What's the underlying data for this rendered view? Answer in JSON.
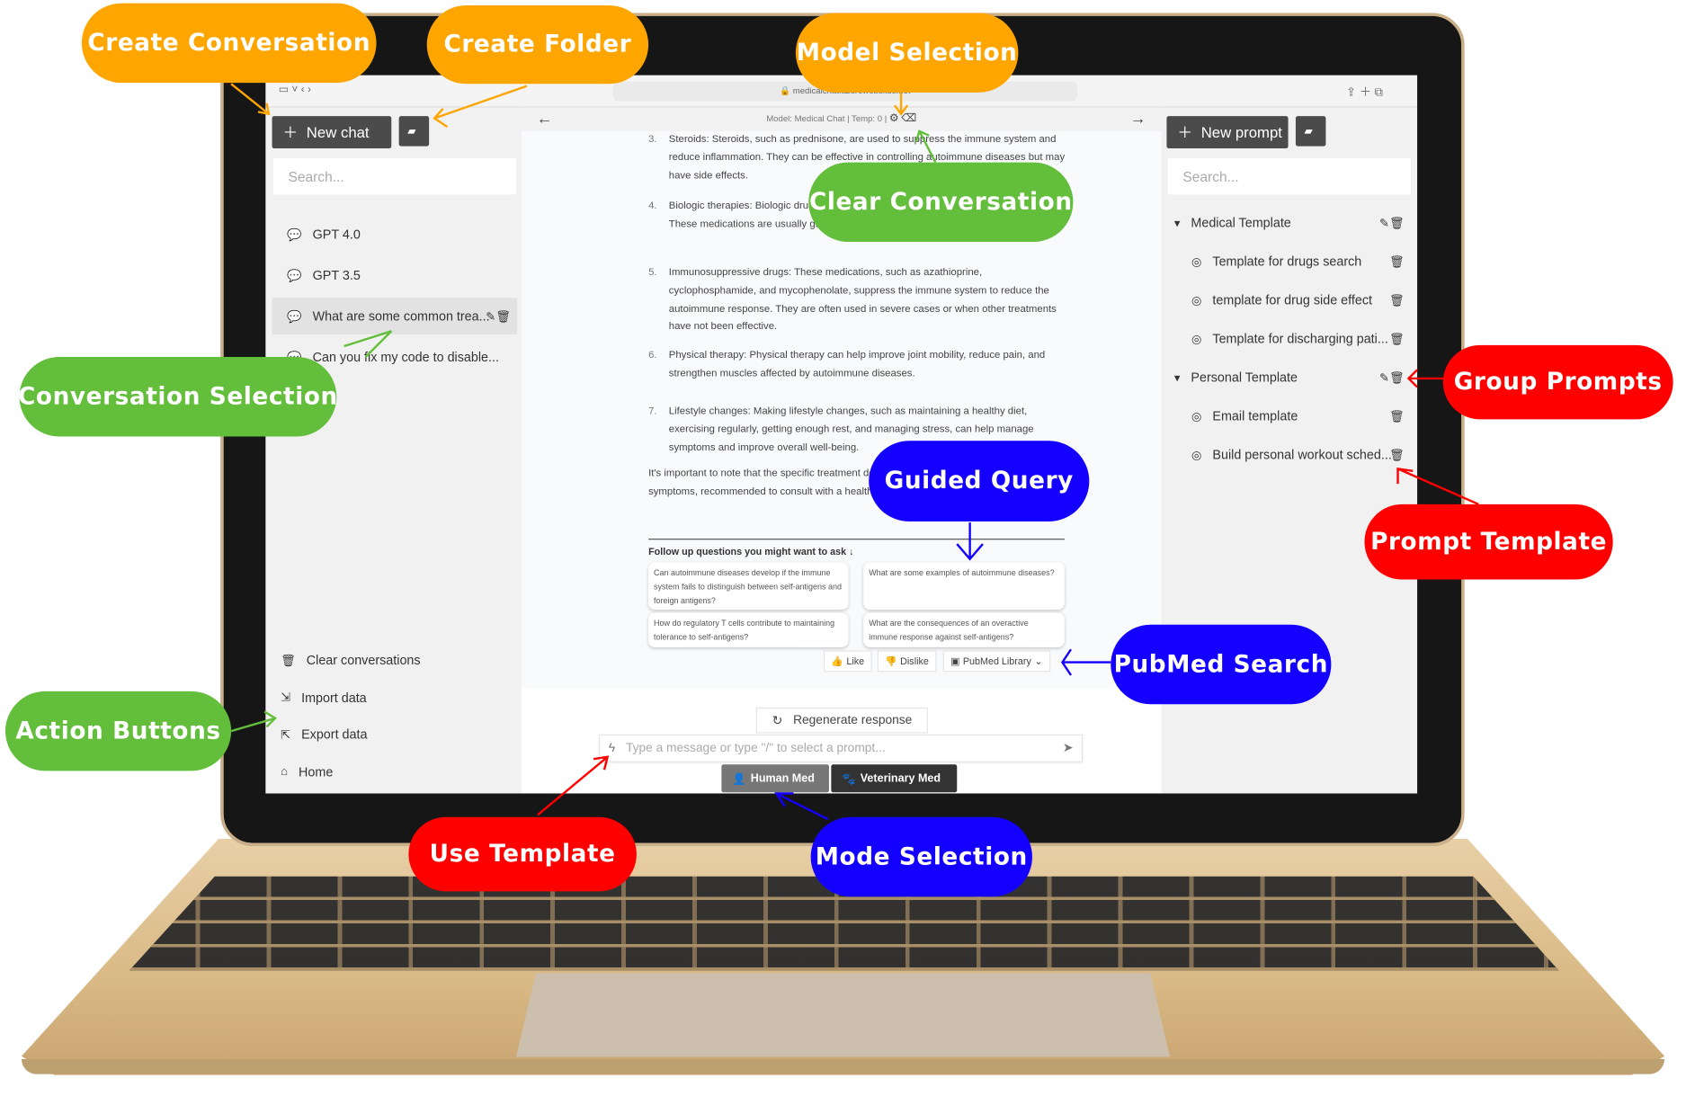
{
  "browser": {
    "url": "medicalchat.azurewebsites.net"
  },
  "left_sidebar": {
    "new_chat": "New chat",
    "search_placeholder": "Search...",
    "conversations": [
      {
        "label": "GPT 4.0"
      },
      {
        "label": "GPT 3.5"
      },
      {
        "label": "What are some common trea...",
        "selected": true
      },
      {
        "label": "Can you fix my code to disable..."
      }
    ],
    "actions": [
      {
        "label": "Clear conversations",
        "icon": "trash-icon"
      },
      {
        "label": "Import data",
        "icon": "import-icon"
      },
      {
        "label": "Export data",
        "icon": "export-icon"
      },
      {
        "label": "Home",
        "icon": "home-icon"
      }
    ]
  },
  "chat": {
    "model_bar": "Model: Medical Chat | Temp: 0 |",
    "items": [
      {
        "num": "3.",
        "text": "Steroids: Steroids, such as prednisone, are used to suppress the immune system and reduce inflammation. They can be effective in controlling autoimmune diseases but may have side effects."
      },
      {
        "num": "4.",
        "text": "Biologic therapies: Biologic drugs target specific molecules in the immune system. These medications are usually given by injection or infusion."
      },
      {
        "num": "5.",
        "text": "Immunosuppressive drugs: These medications, such as azathioprine, cyclophosphamide, and mycophenolate, suppress the immune system to reduce the autoimmune response. They are often used in severe cases or when other treatments have not been effective."
      },
      {
        "num": "6.",
        "text": "Physical therapy: Physical therapy can help improve joint mobility, reduce pain, and strengthen muscles affected by autoimmune diseases."
      },
      {
        "num": "7.",
        "text": "Lifestyle changes: Making lifestyle changes, such as maintaining a healthy diet, exercising regularly, getting enough rest, and managing stress, can help manage symptoms and improve overall well-being."
      }
    ],
    "closing": "It's important to note that the specific treatment depending on the individual's condition, symptoms, recommended to consult with a healthcare professional recommendations.",
    "followup_title": "Follow up questions you might want to ask ↓",
    "followups": [
      "Can autoimmune diseases develop if the immune system fails to distinguish between self-antigens and foreign antigens?",
      "What are some examples of autoimmune diseases?",
      "How do regulatory T cells contribute to maintaining tolerance to self-antigens?",
      "What are the consequences of an overactive immune response against self-antigens?"
    ],
    "like": "Like",
    "dislike": "Dislike",
    "pubmed": "PubMed Library",
    "regenerate": "Regenerate response",
    "input_placeholder": "Type a message or type \"/\" to select a prompt...",
    "modes": [
      {
        "label": "Human Med",
        "active": true
      },
      {
        "label": "Veterinary Med",
        "active": false
      }
    ]
  },
  "right_sidebar": {
    "new_prompt": "New prompt",
    "search_placeholder": "Search...",
    "folders": [
      {
        "name": "Medical Template",
        "prompts": [
          "Template for drugs search",
          "template for drug side effect",
          "Template for discharging pati..."
        ]
      },
      {
        "name": "Personal Template",
        "prompts": [
          "Email template",
          "Build personal workout sched..."
        ]
      }
    ]
  },
  "callouts": {
    "create_conversation": "Create Conversation",
    "create_folder": "Create Folder",
    "model_selection": "Model Selection",
    "clear_conversation": "Clear Conversation",
    "conversation_selection": "Conversation Selection",
    "group_prompts": "Group Prompts",
    "guided_query": "Guided Query",
    "prompt_template": "Prompt Template",
    "pubmed_search": "PubMed Search",
    "action_buttons": "Action Buttons",
    "use_template": "Use Template",
    "mode_selection": "Mode Selection"
  },
  "colors": {
    "orange": "#FFA500",
    "green": "#63BE3B",
    "blue": "#1400FF",
    "red": "#FF0000"
  }
}
